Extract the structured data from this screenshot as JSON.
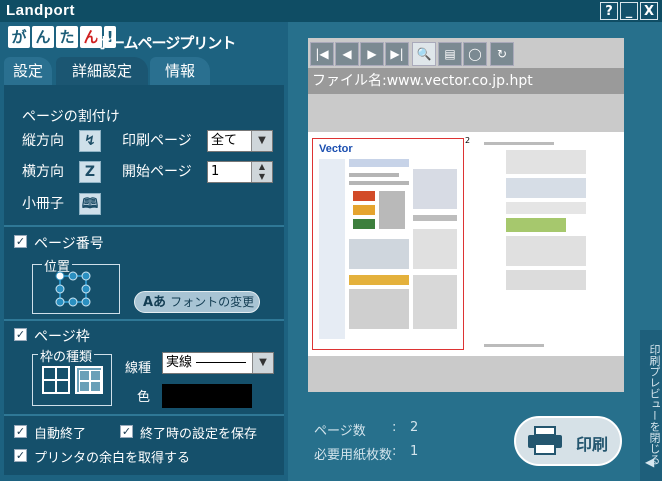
{
  "window": {
    "brand": "Landport",
    "help_btn": "?",
    "min_btn": "_",
    "close_btn": "X"
  },
  "logo": {
    "chars": [
      "が",
      "ん",
      "た",
      "ん",
      "!"
    ],
    "text": "ホームページプリント"
  },
  "tabs": [
    {
      "label": "設定"
    },
    {
      "label": "詳細設定"
    },
    {
      "label": "情報"
    }
  ],
  "layout": {
    "heading": "ページの割付け",
    "portrait_label": "縦方向",
    "landscape_label": "横方向",
    "booklet_label": "小冊子",
    "print_pages_label": "印刷ページ",
    "print_pages_value": "全て",
    "start_page_label": "開始ページ",
    "start_page_value": "1"
  },
  "page_number": {
    "checkbox_label": "ページ番号",
    "position_label": "位置",
    "font_button_icon": "Aあ",
    "font_button_label": "フォントの変更"
  },
  "page_frame": {
    "checkbox_label": "ページ枠",
    "frame_type_label": "枠の種類",
    "line_type_label": "線種",
    "line_type_value": "実線",
    "color_label": "色",
    "color_value": "#000000"
  },
  "options": {
    "auto_exit_label": "自動終了",
    "save_on_exit_label": "終了時の設定を保存",
    "printer_margin_label": "プリンタの余白を取得する"
  },
  "preview": {
    "filename_label": "ファイル名:www.vector.co.jp.hpt",
    "page_number_marker": "2",
    "mini_logo": "Vector"
  },
  "summary": {
    "page_count_label": "ページ数",
    "page_count_value": "2",
    "paper_count_label": "必要用紙枚数",
    "paper_count_value": "1",
    "colon": ":"
  },
  "print_button_label": "印刷",
  "side_tab_label": "印刷プレビューを閉じる"
}
